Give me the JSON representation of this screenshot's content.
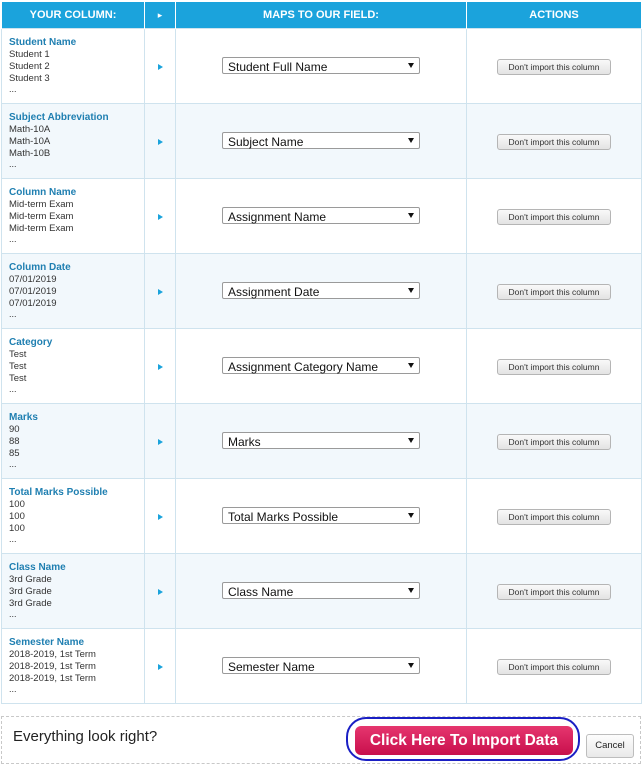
{
  "header": {
    "your_column": "YOUR COLUMN:",
    "arrow": "▸",
    "maps_to": "MAPS TO OUR FIELD:",
    "actions": "ACTIONS"
  },
  "rows": [
    {
      "name": "Student Name",
      "samples": [
        "Student 1",
        "Student 2",
        "Student 3"
      ],
      "more": "...",
      "field": "Student Full Name",
      "action": "Don't import this column"
    },
    {
      "name": "Subject Abbreviation",
      "samples": [
        "Math-10A",
        "Math-10A",
        "Math-10B"
      ],
      "more": "...",
      "field": "Subject Name",
      "action": "Don't import this column"
    },
    {
      "name": "Column Name",
      "samples": [
        "Mid-term Exam",
        "Mid-term Exam",
        "Mid-term Exam"
      ],
      "more": "...",
      "field": "Assignment Name",
      "action": "Don't import this column"
    },
    {
      "name": "Column Date",
      "samples": [
        "07/01/2019",
        "07/01/2019",
        "07/01/2019"
      ],
      "more": "...",
      "field": "Assignment Date",
      "action": "Don't import this column"
    },
    {
      "name": "Category",
      "samples": [
        "Test",
        "Test",
        "Test"
      ],
      "more": "...",
      "field": "Assignment Category Name",
      "action": "Don't import this column"
    },
    {
      "name": "Marks",
      "samples": [
        "90",
        "88",
        "85"
      ],
      "more": "...",
      "field": "Marks",
      "action": "Don't import this column"
    },
    {
      "name": "Total Marks Possible",
      "samples": [
        "100",
        "100",
        "100"
      ],
      "more": "...",
      "field": "Total Marks Possible",
      "action": "Don't import this column"
    },
    {
      "name": "Class Name",
      "samples": [
        "3rd Grade",
        "3rd Grade",
        "3rd Grade"
      ],
      "more": "...",
      "field": "Class Name",
      "action": "Don't import this column"
    },
    {
      "name": "Semester Name",
      "samples": [
        "2018-2019, 1st Term",
        "2018-2019, 1st Term",
        "2018-2019, 1st Term"
      ],
      "more": "...",
      "field": "Semester Name",
      "action": "Don't import this column"
    }
  ],
  "footer": {
    "question": "Everything look right?",
    "import_label": "Click Here To Import Data",
    "cancel_label": "Cancel"
  },
  "colors": {
    "header_bg": "#1ba3dc",
    "column_name_text": "#1f7fb1",
    "import_button": "#d91b5c",
    "highlight_ring": "#1a1fc4"
  }
}
